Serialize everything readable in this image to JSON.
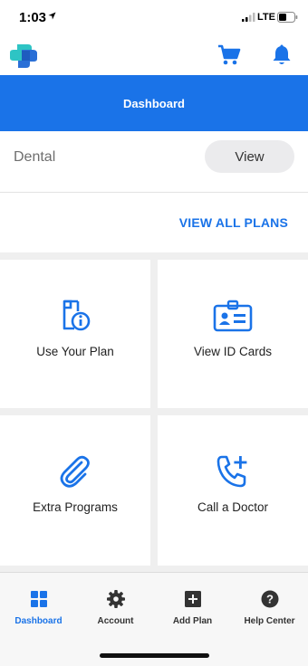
{
  "status": {
    "time": "1:03",
    "network": "LTE"
  },
  "header": {
    "title": "Dashboard"
  },
  "plan": {
    "name": "Dental",
    "view_label": "View"
  },
  "view_all_label": "VIEW ALL PLANS",
  "tiles": [
    {
      "label": "Use Your Plan",
      "icon": "document-info-icon"
    },
    {
      "label": "View ID Cards",
      "icon": "id-card-icon"
    },
    {
      "label": "Extra Programs",
      "icon": "paperclip-icon"
    },
    {
      "label": "Call a Doctor",
      "icon": "phone-plus-icon"
    }
  ],
  "tabs": [
    {
      "label": "Dashboard",
      "icon": "grid-icon",
      "active": true
    },
    {
      "label": "Account",
      "icon": "gear-icon",
      "active": false
    },
    {
      "label": "Add Plan",
      "icon": "plus-square-icon",
      "active": false
    },
    {
      "label": "Help Center",
      "icon": "question-circle-icon",
      "active": false
    }
  ],
  "colors": {
    "accent": "#1a73e8",
    "logo_teal": "#2ec4c4",
    "logo_blue": "#2a6fd6"
  }
}
